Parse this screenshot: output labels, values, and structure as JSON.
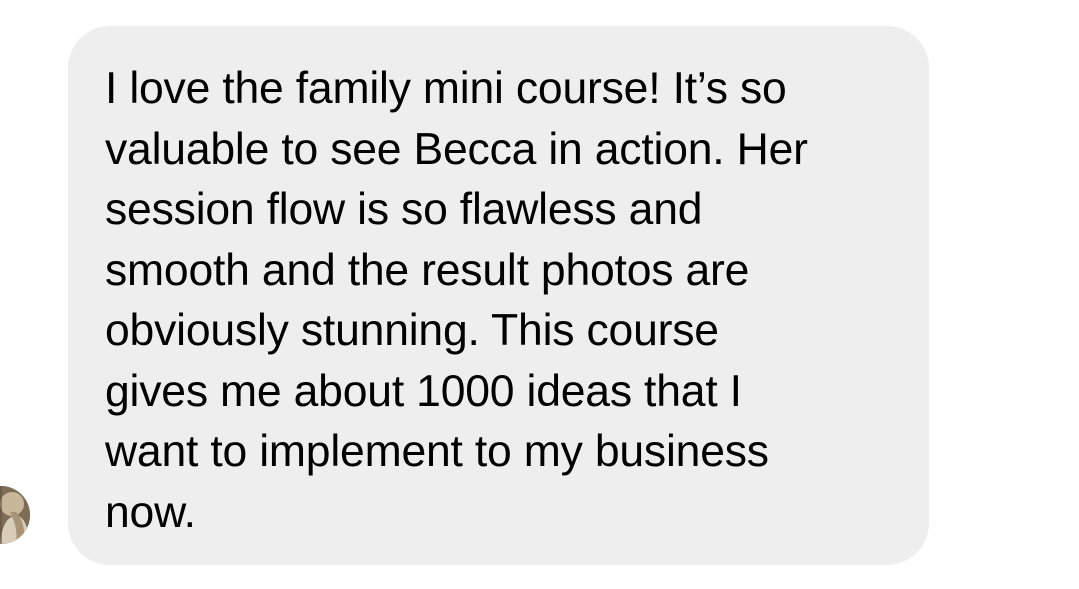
{
  "conversation": {
    "message": {
      "text": "I love the family mini course! It’s so\nvaluable to see Becca in action. Her\nsession flow is so flawless and\nsmooth and the result photos are\nobviously stunning. This course\ngives me about 1000 ideas that I\nwant to implement to my business\nnow."
    },
    "sender": {
      "avatar_icon": "user-avatar"
    }
  },
  "colors": {
    "bubble_background": "#eeeeee",
    "text": "#000000",
    "page_background": "#ffffff"
  }
}
